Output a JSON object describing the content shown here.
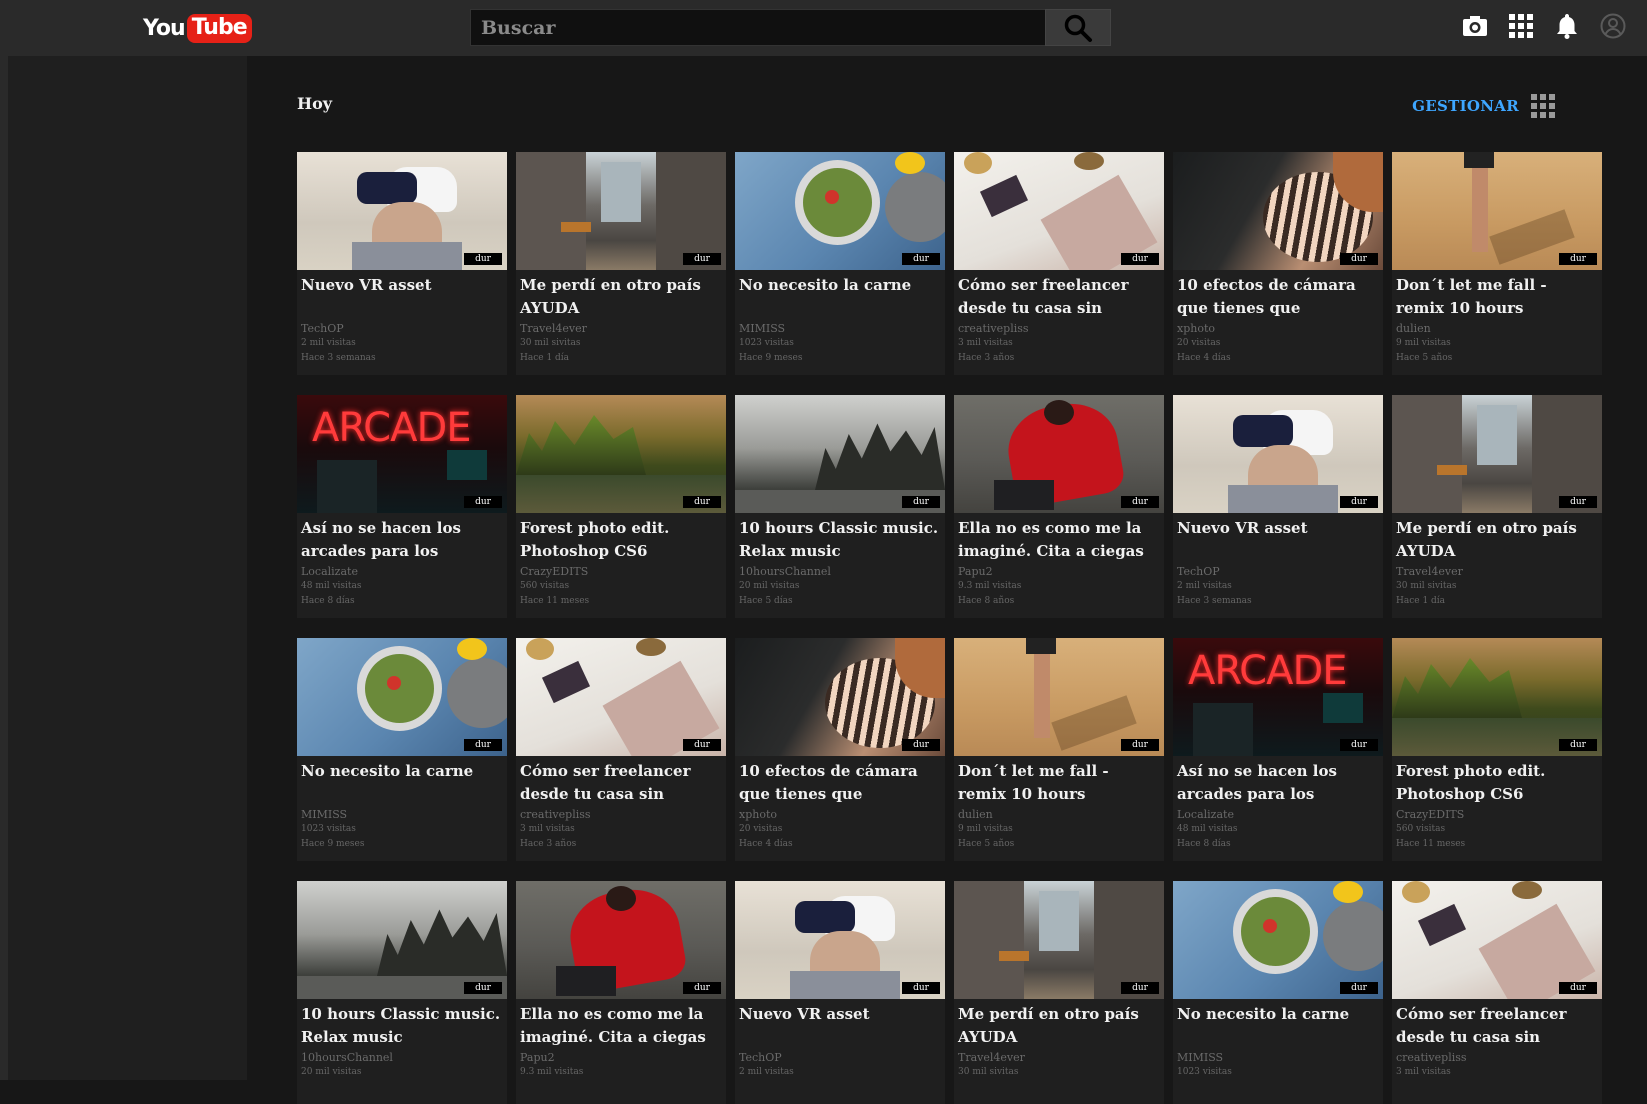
{
  "header": {
    "logo_you": "You",
    "logo_tube": "Tube",
    "search_placeholder": "Buscar",
    "icons": [
      "camera-icon",
      "apps-icon",
      "bell-icon",
      "account-icon"
    ]
  },
  "main": {
    "section_title": "Hoy",
    "manage_label": "GESTIONAR"
  },
  "videos": [
    {
      "title": "Nuevo VR asset",
      "channel": "TechOP",
      "views": "2 mil visitas",
      "date": "Hace 3 semanas",
      "duration": "dur",
      "thumb": "vr"
    },
    {
      "title": "Me perdí en otro país AYUDA",
      "channel": "Travel4ever",
      "views": "30 mil sivitas",
      "date": "Hace 1 día",
      "duration": "dur",
      "thumb": "city"
    },
    {
      "title": "No necesito la carne",
      "channel": "MIMISS",
      "views": "1023 visitas",
      "date": "Hace 9 meses",
      "duration": "dur",
      "thumb": "food"
    },
    {
      "title": "Cómo ser freelancer desde tu casa sin",
      "channel": "creativepliss",
      "views": "3 mil visitas",
      "date": "Hace 3 años",
      "duration": "dur",
      "thumb": "free"
    },
    {
      "title": "10 efectos de cámara que tienes que",
      "channel": "xphoto",
      "views": "20 visitas",
      "date": "Hace 4 días",
      "duration": "dur",
      "thumb": "light"
    },
    {
      "title": "Don´t let me fall - remix 10 hours",
      "channel": "dulien",
      "views": "9 mil visitas",
      "date": "Hace 5 años",
      "duration": "dur",
      "thumb": "beach"
    },
    {
      "title": "Así no se hacen los arcades para los",
      "channel": "Localizate",
      "views": "48 mil visitas",
      "date": "Hace 8 días",
      "duration": "dur",
      "thumb": "arcade"
    },
    {
      "title": "Forest photo edit. Photoshop CS6",
      "channel": "CrazyEDITS",
      "views": "560 visitas",
      "date": "Hace 11 meses",
      "duration": "dur",
      "thumb": "forest"
    },
    {
      "title": "10 hours Classic music. Relax music",
      "channel": "10hoursChannel",
      "views": "20 mil visitas",
      "date": "Hace 5 días",
      "duration": "dur",
      "thumb": "snow"
    },
    {
      "title": "Ella no es como me la imaginé. Cita a ciegas",
      "channel": "Papu2",
      "views": "9.3 mil visitas",
      "date": "Hace 8 años",
      "duration": "dur",
      "thumb": "red"
    },
    {
      "title": "Nuevo VR asset",
      "channel": "TechOP",
      "views": "2 mil visitas",
      "date": "Hace 3 semanas",
      "duration": "dur",
      "thumb": "vr"
    },
    {
      "title": "Me perdí en otro país AYUDA",
      "channel": "Travel4ever",
      "views": "30 mil sivitas",
      "date": "Hace 1 día",
      "duration": "dur",
      "thumb": "city"
    },
    {
      "title": "No necesito la carne",
      "channel": "MIMISS",
      "views": "1023 visitas",
      "date": "Hace 9 meses",
      "duration": "dur",
      "thumb": "food"
    },
    {
      "title": "Cómo ser freelancer desde tu casa sin",
      "channel": "creativepliss",
      "views": "3 mil visitas",
      "date": "Hace 3 años",
      "duration": "dur",
      "thumb": "free"
    },
    {
      "title": "10 efectos de cámara que tienes que",
      "channel": "xphoto",
      "views": "20 visitas",
      "date": "Hace 4 días",
      "duration": "dur",
      "thumb": "light"
    },
    {
      "title": "Don´t let me fall - remix 10 hours",
      "channel": "dulien",
      "views": "9 mil visitas",
      "date": "Hace 5 años",
      "duration": "dur",
      "thumb": "beach"
    },
    {
      "title": "Así no se hacen los arcades para los",
      "channel": "Localizate",
      "views": "48 mil visitas",
      "date": "Hace 8 días",
      "duration": "dur",
      "thumb": "arcade"
    },
    {
      "title": "Forest photo edit. Photoshop CS6",
      "channel": "CrazyEDITS",
      "views": "560 visitas",
      "date": "Hace 11 meses",
      "duration": "dur",
      "thumb": "forest"
    },
    {
      "title": "10 hours Classic music. Relax music",
      "channel": "10hoursChannel",
      "views": "20 mil visitas",
      "date": "",
      "duration": "dur",
      "thumb": "snow"
    },
    {
      "title": "Ella no es como me la imaginé. Cita a ciegas",
      "channel": "Papu2",
      "views": "9.3 mil visitas",
      "date": "",
      "duration": "dur",
      "thumb": "red"
    },
    {
      "title": "Nuevo VR asset",
      "channel": "TechOP",
      "views": "2 mil visitas",
      "date": "",
      "duration": "dur",
      "thumb": "vr"
    },
    {
      "title": "Me perdí en otro país AYUDA",
      "channel": "Travel4ever",
      "views": "30 mil sivitas",
      "date": "",
      "duration": "dur",
      "thumb": "city"
    },
    {
      "title": "No necesito la carne",
      "channel": "MIMISS",
      "views": "1023 visitas",
      "date": "",
      "duration": "dur",
      "thumb": "food"
    },
    {
      "title": "Cómo ser freelancer desde tu casa sin",
      "channel": "creativepliss",
      "views": "3 mil visitas",
      "date": "",
      "duration": "dur",
      "thumb": "free"
    }
  ]
}
